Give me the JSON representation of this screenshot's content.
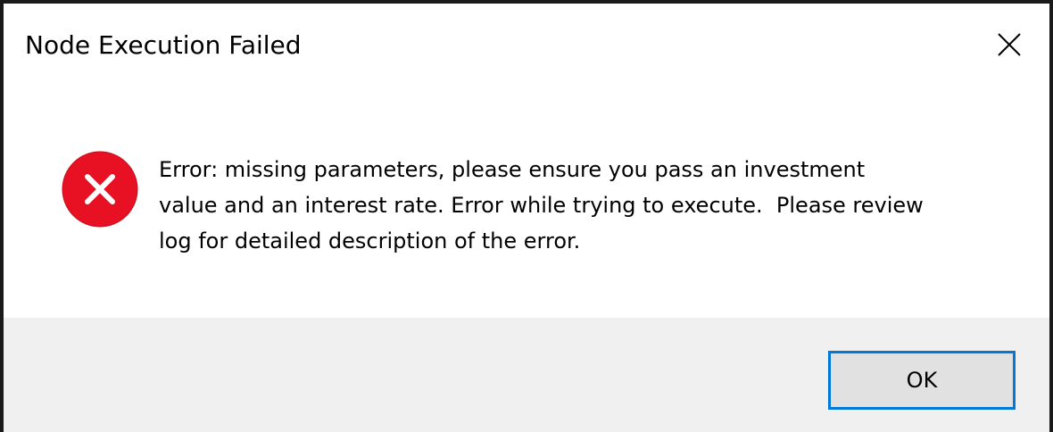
{
  "dialog": {
    "title": "Node Execution Failed",
    "close_icon": "close-icon",
    "status_icon": "error-circle-x-icon",
    "message": "Error: missing parameters, please ensure you pass an investment\nvalue and an interest rate. Error while trying to execute.  Please review\nlog for detailed description of the error.",
    "ok_label": "OK"
  },
  "colors": {
    "error_red": "#e81123",
    "button_border": "#0078d7",
    "button_bg": "#e1e1e1",
    "footer_bg": "#f0f0f0"
  }
}
